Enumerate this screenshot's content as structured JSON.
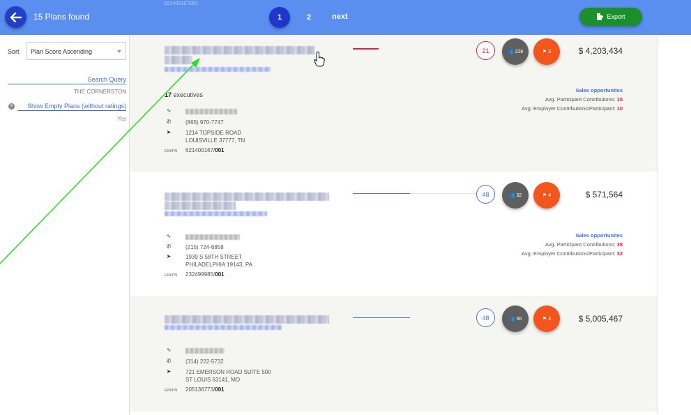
{
  "header": {
    "plans_found": "15 Plans found",
    "pages": [
      "1",
      "2"
    ],
    "next_label": "next",
    "export_label": "Export",
    "ghost_ein": "621400167/001"
  },
  "sidebar": {
    "sort_label": "Sort",
    "sort_value": "Plan Score Ascending",
    "search_query_label": "Search Query",
    "search_query_value": "THE CORNERSTON",
    "show_empty_label": "Show Empty Plans (without ratings)",
    "show_empty_value": "Yes"
  },
  "plans": [
    {
      "executives_count": "17",
      "executives_label": "executives",
      "phone": "(865) 970-7747",
      "address1": "1214 TOPSIDE ROAD",
      "address2": "LOUISVILLE 37777, TN",
      "ein_label": "EIN/PN",
      "ein": "621400167/",
      "pn": "001",
      "score": "21",
      "participants": "228",
      "flags": "3",
      "amount": "$ 4,203,434",
      "sales_title": "Sales opportunites",
      "participant_label": "Avg. Participant Contributions:",
      "participant_value": "15",
      "employer_label": "Avg. Employer Contributions/Participant:",
      "employer_value": "10"
    },
    {
      "phone": "(215) 724-6858",
      "address1": "1939 S 58TH STREET",
      "address2": "PHILADELPHIA 19143, PA",
      "ein_label": "EIN/PN",
      "ein": "232499985/",
      "pn": "001",
      "score": "48",
      "participants": "32",
      "flags": "4",
      "amount": "$ 571,564",
      "sales_title": "Sales opportunites",
      "participant_label": "Avg. Participant Contributions:",
      "participant_value": "38",
      "employer_label": "Avg. Employer Contributions/Participant:",
      "employer_value": "32"
    },
    {
      "phone": "(314) 222-5732",
      "address1": "721 EMERSON ROAD SUITE 500",
      "address2": "ST LOUIS 63141, MO",
      "ein_label": "EIN/PN",
      "ein": "205136773/",
      "pn": "001",
      "score": "48",
      "participants": "56",
      "flags": "4",
      "amount": "$ 5,005,467"
    }
  ],
  "colors": {
    "topbar": "#5a8ff0",
    "active_page": "#1f36cc",
    "export": "#1a8f2a",
    "score_red": "#e0223d",
    "score_blue": "#4a73e0",
    "flag": "#f2561d",
    "people": "#5f5f5f",
    "annotation_arrow": "#22e022"
  }
}
